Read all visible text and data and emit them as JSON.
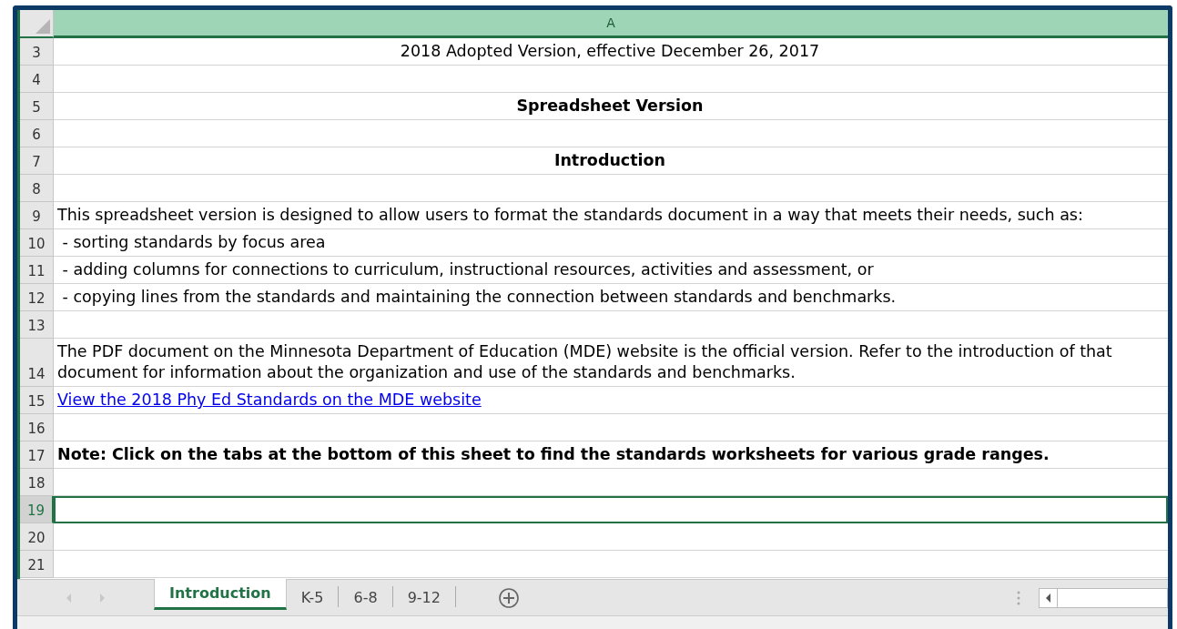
{
  "column_headers": [
    {
      "label": "A",
      "selected": true
    }
  ],
  "rows": [
    {
      "number": "3",
      "text": "2018 Adopted Version, effective December 26, 2017",
      "kind": "text",
      "centered": true,
      "bold": false,
      "selected": false
    },
    {
      "number": "4",
      "kind": "empty",
      "selected": false
    },
    {
      "number": "5",
      "text": "Spreadsheet Version",
      "kind": "text",
      "centered": true,
      "bold": true,
      "selected": false
    },
    {
      "number": "6",
      "kind": "empty",
      "selected": false
    },
    {
      "number": "7",
      "text": "Introduction",
      "kind": "text",
      "centered": true,
      "bold": true,
      "selected": false
    },
    {
      "number": "8",
      "kind": "empty",
      "selected": false
    },
    {
      "number": "9",
      "text": "This spreadsheet version is designed to allow users to format the standards document in a way that meets their needs, such as:",
      "kind": "text",
      "centered": false,
      "bold": false,
      "selected": false
    },
    {
      "number": "10",
      "text": " - sorting standards by focus area",
      "kind": "text",
      "centered": false,
      "bold": false,
      "selected": false
    },
    {
      "number": "11",
      "text": " - adding columns for connections to curriculum, instructional resources, activities and assessment, or",
      "kind": "text",
      "centered": false,
      "bold": false,
      "selected": false
    },
    {
      "number": "12",
      "text": " - copying lines from the standards and maintaining the connection between standards and benchmarks.",
      "kind": "text",
      "centered": false,
      "bold": false,
      "selected": false
    },
    {
      "number": "13",
      "kind": "empty",
      "selected": false
    },
    {
      "number": "14",
      "text": "The PDF document on the Minnesota Department of Education (MDE) website is the official version. Refer to the introduction of that document for information about the organization and use of the standards and benchmarks.",
      "kind": "text",
      "centered": false,
      "bold": false,
      "selected": false
    },
    {
      "number": "15",
      "text": "View the 2018 Phy Ed Standards on the MDE website",
      "kind": "link",
      "centered": false,
      "bold": false,
      "selected": false
    },
    {
      "number": "16",
      "kind": "empty",
      "selected": false
    },
    {
      "number": "17",
      "text": "Note: Click on the tabs at the bottom of this sheet to find the standards worksheets for various grade ranges.",
      "kind": "text",
      "centered": false,
      "bold": true,
      "selected": false
    },
    {
      "number": "18",
      "kind": "empty",
      "selected": false
    },
    {
      "number": "19",
      "kind": "empty",
      "selected": true
    },
    {
      "number": "20",
      "kind": "empty",
      "selected": false
    },
    {
      "number": "21",
      "kind": "empty",
      "selected": false
    }
  ],
  "sheet_tabs": [
    {
      "label": "Introduction",
      "selected": true
    },
    {
      "label": "K-5",
      "selected": false
    },
    {
      "label": "6-8",
      "selected": false
    },
    {
      "label": "9-12",
      "selected": false
    }
  ]
}
